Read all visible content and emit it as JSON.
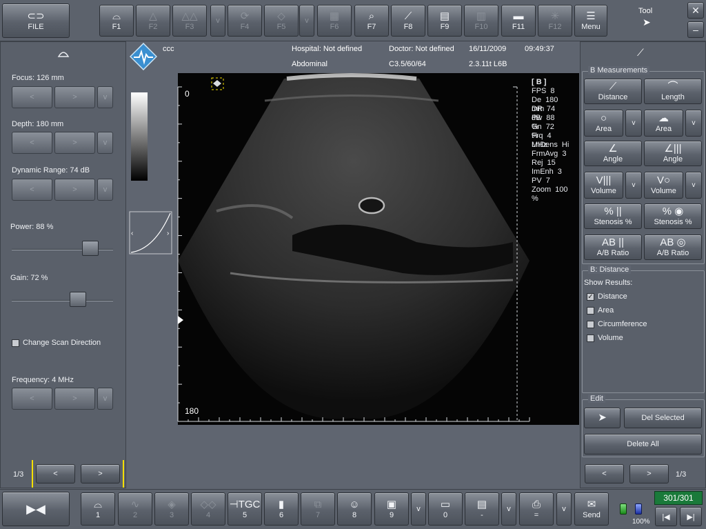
{
  "top_toolbar": {
    "file": "FILE",
    "keys": [
      {
        "label": "F1",
        "icon": "probe-icon",
        "enabled": true
      },
      {
        "label": "F2",
        "icon": "probe-beam-icon",
        "enabled": false
      },
      {
        "label": "F3",
        "icon": "dual-probe-icon",
        "enabled": false
      },
      {
        "label": "v",
        "icon": "",
        "enabled": false
      },
      {
        "label": "F4",
        "icon": "rotate-icon",
        "enabled": false
      },
      {
        "label": "F5",
        "icon": "probe-outline-icon",
        "enabled": false
      },
      {
        "label": "v",
        "icon": "",
        "enabled": false
      },
      {
        "label": "F6",
        "icon": "layout-icon",
        "enabled": false
      },
      {
        "label": "F7",
        "icon": "zoom-icon",
        "enabled": true
      },
      {
        "label": "F8",
        "icon": "measure-icon",
        "enabled": true
      },
      {
        "label": "F9",
        "icon": "calculator-icon",
        "enabled": true
      },
      {
        "label": "F10",
        "icon": "grid-icon",
        "enabled": false
      },
      {
        "label": "F11",
        "icon": "film-icon",
        "enabled": true
      },
      {
        "label": "F12",
        "icon": "sparkle-icon",
        "enabled": false
      },
      {
        "label": "Menu",
        "icon": "menu-icon",
        "enabled": true
      }
    ],
    "tool_label": "Tool"
  },
  "header": {
    "patient": "ccc",
    "hospital": "Hospital: Not defined",
    "doctor": "Doctor: Not defined",
    "date": "16/11/2009",
    "time": "09:49:37",
    "preset": "Abdominal",
    "probe": "C3.5/60/64",
    "version": "2.3.11t L6B"
  },
  "left_panel": {
    "focus_label": "Focus: 126 mm",
    "depth_label": "Depth: 180 mm",
    "dynamic_range_label": "Dynamic Range: 74 dB",
    "power_label": "Power: 88 %",
    "power_value": 88,
    "gain_label": "Gain: 72 %",
    "gain_value": 72,
    "change_scan_direction": "Change Scan Direction",
    "frequency_label": "Frequency: 4 MHz",
    "step_left": "<",
    "step_right": ">",
    "step_more": "v",
    "page": "1/3"
  },
  "image_area": {
    "depth_top": "0",
    "depth_bottom": "180",
    "mode": "[ B ]",
    "params": [
      {
        "k": "FPS",
        "v": "8"
      },
      {
        "k": "De",
        "v": "180 mm"
      },
      {
        "k": "DR",
        "v": "74 dB"
      },
      {
        "k": "Pw",
        "v": "88 %"
      },
      {
        "k": "Gn",
        "v": "72 %"
      },
      {
        "k": "Frq",
        "v": "4 MHz"
      },
      {
        "k": "LnDens",
        "v": "Hi"
      },
      {
        "k": "FrmAvg",
        "v": "3"
      },
      {
        "k": "Rej",
        "v": "15"
      },
      {
        "k": "ImEnh",
        "v": "3"
      },
      {
        "k": "PV",
        "v": "7"
      },
      {
        "k": "Zoom",
        "v": "100 %"
      }
    ]
  },
  "right_panel": {
    "group_measure": "B Measurements",
    "distance": "Distance",
    "length": "Length",
    "area1": "Area",
    "area2": "Area",
    "angle1": "Angle",
    "angle2": "Angle",
    "volume1": "Volume",
    "volume2": "Volume",
    "stenosis1": "Stenosis %",
    "stenosis2": "Stenosis %",
    "ratio1": "A/B Ratio",
    "ratio2": "A/B Ratio",
    "more": "v",
    "group_distance": "B: Distance",
    "show_results": "Show Results:",
    "results": [
      {
        "label": "Distance",
        "checked": true
      },
      {
        "label": "Area",
        "checked": false
      },
      {
        "label": "Circumference",
        "checked": false
      },
      {
        "label": "Volume",
        "checked": false
      }
    ],
    "group_edit": "Edit",
    "del_selected": "Del Selected",
    "delete_all": "Delete All",
    "page": "1/3",
    "prev": "<",
    "next": ">"
  },
  "bottom_toolbar": {
    "keys": [
      {
        "label": "1",
        "icon": "probe-icon",
        "enabled": true
      },
      {
        "label": "2",
        "icon": "waveform-icon",
        "enabled": false
      },
      {
        "label": "3",
        "icon": "probe-color-icon",
        "enabled": false
      },
      {
        "label": "4",
        "icon": "probe-pair-icon",
        "enabled": false
      },
      {
        "label": "5",
        "icon": "tgc-icon",
        "enabled": true
      },
      {
        "label": "6",
        "icon": "grayscale-icon",
        "enabled": true
      },
      {
        "label": "7",
        "icon": "stack-icon",
        "enabled": false
      },
      {
        "label": "8",
        "icon": "person-icon",
        "enabled": true
      },
      {
        "label": "9",
        "icon": "save-icon",
        "enabled": true
      },
      {
        "label": "v",
        "icon": "",
        "enabled": true
      },
      {
        "label": "0",
        "icon": "folder-icon",
        "enabled": true
      },
      {
        "label": "-",
        "icon": "report-icon",
        "enabled": true
      },
      {
        "label": "v",
        "icon": "",
        "enabled": true
      },
      {
        "label": "=",
        "icon": "print-icon",
        "enabled": true
      },
      {
        "label": "v",
        "icon": "",
        "enabled": true
      },
      {
        "label": "Send",
        "icon": "send-icon",
        "enabled": true
      }
    ],
    "battery_pct": "100%",
    "frame_counter": "301/301"
  },
  "colors": {
    "background": "#5f6570",
    "counter_bg": "#1a7a3a",
    "crosshair": "#f5e000"
  }
}
